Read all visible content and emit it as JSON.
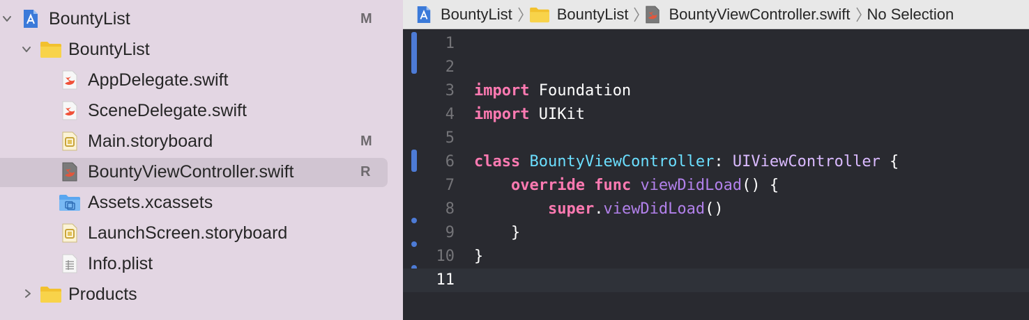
{
  "navigator": {
    "rows": [
      {
        "label": "BountyList",
        "badge": "M",
        "icon": "xcode-project-icon",
        "disclosure": "chevron-down-icon"
      },
      {
        "label": "BountyList",
        "badge": "",
        "icon": "folder-icon",
        "disclosure": "chevron-down-icon"
      },
      {
        "label": "AppDelegate.swift",
        "badge": "",
        "icon": "swift-file-icon"
      },
      {
        "label": "SceneDelegate.swift",
        "badge": "",
        "icon": "swift-file-icon"
      },
      {
        "label": "Main.storyboard",
        "badge": "M",
        "icon": "storyboard-icon"
      },
      {
        "label": "BountyViewController.swift",
        "badge": "R",
        "icon": "swift-file-gray-icon",
        "selected": true
      },
      {
        "label": "Assets.xcassets",
        "badge": "",
        "icon": "asset-catalog-icon"
      },
      {
        "label": "LaunchScreen.storyboard",
        "badge": "",
        "icon": "storyboard-icon"
      },
      {
        "label": "Info.plist",
        "badge": "",
        "icon": "plist-icon"
      },
      {
        "label": "Products",
        "badge": "",
        "icon": "folder-icon",
        "disclosure": "chevron-right-icon"
      }
    ]
  },
  "jumpbar": {
    "crumbs": [
      {
        "label": "BountyList",
        "icon": "xcode-project-icon"
      },
      {
        "label": "BountyList",
        "icon": "folder-icon"
      },
      {
        "label": "BountyViewController.swift",
        "icon": "swift-file-gray-icon"
      },
      {
        "label": "No Selection",
        "icon": ""
      }
    ]
  },
  "editor": {
    "line_numbers": [
      "1",
      "2",
      "3",
      "4",
      "5",
      "6",
      "7",
      "8",
      "9",
      "10",
      "11"
    ],
    "current_line": 11,
    "code": {
      "l3": {
        "kw": "import",
        "rest": " Foundation"
      },
      "l4": {
        "kw": "import",
        "rest": " UIKit"
      },
      "l6": {
        "kw": "class",
        "name": "BountyViewController",
        "colon": ": ",
        "super": "UIViewController",
        "brace": " {"
      },
      "l7": {
        "indent": "    ",
        "kw1": "override",
        "kw2": "func",
        "fn": "viewDidLoad",
        "rest": "() {"
      },
      "l8": {
        "indent": "        ",
        "kw": "super",
        "dot": ".",
        "fn": "viewDidLoad",
        "rest": "()"
      },
      "l9": {
        "text": "    }"
      },
      "l10": {
        "text": "}"
      }
    }
  },
  "colors": {
    "keyword": "#ff7ab2",
    "type_declaration": "#6bdfff",
    "type_reference": "#dabaff",
    "function": "#b281eb",
    "change_marker": "#4d7bd6",
    "navigator_bg": "#e3d6e3",
    "editor_bg": "#292a30"
  }
}
